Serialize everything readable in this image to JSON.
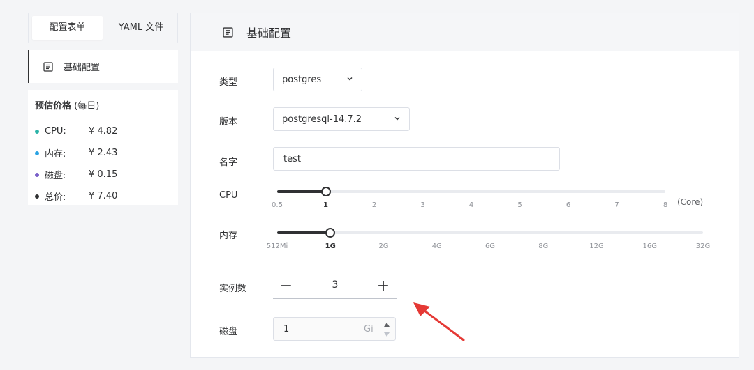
{
  "tabs": [
    {
      "label": "配置表单",
      "active": true
    },
    {
      "label": "YAML 文件",
      "active": false
    }
  ],
  "nav": {
    "label": "基础配置",
    "icon": "document-icon"
  },
  "price": {
    "title_bold": "预估价格",
    "title_rest": " (每日)",
    "rows": [
      {
        "label": "CPU:",
        "value": "¥ 4.82",
        "color": "#2bb3a8"
      },
      {
        "label": "内存:",
        "value": "¥ 2.43",
        "color": "#2aa3e3"
      },
      {
        "label": "磁盘:",
        "value": "¥ 0.15",
        "color": "#7b61c9"
      },
      {
        "label": "总价:",
        "value": "¥ 7.40",
        "color": "#303133"
      }
    ]
  },
  "panel": {
    "title": "基础配置",
    "type": {
      "label": "类型",
      "value": "postgres"
    },
    "version": {
      "label": "版本",
      "value": "postgresql-14.7.2"
    },
    "name": {
      "label": "名字",
      "value": "test"
    },
    "cpu": {
      "label": "CPU",
      "ticks": [
        "0.5",
        "1",
        "2",
        "3",
        "4",
        "5",
        "6",
        "7",
        "8"
      ],
      "selected_index": 1,
      "unit": "(Core)"
    },
    "memory": {
      "label": "内存",
      "ticks": [
        "512Mi",
        "1G",
        "2G",
        "4G",
        "6G",
        "8G",
        "12G",
        "16G",
        "32G"
      ],
      "selected_index": 1
    },
    "instances": {
      "label": "实例数",
      "value": "3",
      "minus": "−",
      "plus": "+"
    },
    "disk": {
      "label": "磁盘",
      "value": "1",
      "unit": "Gi"
    }
  },
  "colors": {
    "accent": "#303133",
    "arrow": "#e53935"
  }
}
